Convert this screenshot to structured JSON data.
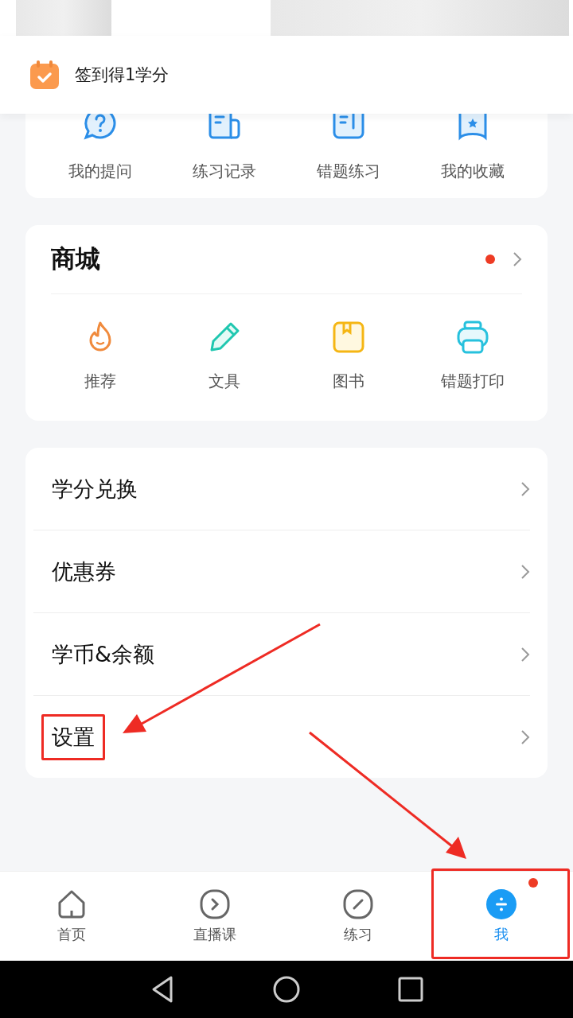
{
  "signin_banner": {
    "label": "签到得1学分"
  },
  "quick_links": [
    {
      "label": "我的提问",
      "kind": "question"
    },
    {
      "label": "练习记录",
      "kind": "record"
    },
    {
      "label": "错题练习",
      "kind": "notes"
    },
    {
      "label": "我的收藏",
      "kind": "bookmark"
    }
  ],
  "shop": {
    "title": "商城",
    "dot": true,
    "items": [
      {
        "label": "推荐",
        "kind": "flame"
      },
      {
        "label": "文具",
        "kind": "pencil"
      },
      {
        "label": "图书",
        "kind": "book"
      },
      {
        "label": "错题打印",
        "kind": "printer"
      }
    ]
  },
  "menu": [
    {
      "label": "学分兑换",
      "highlighted": false
    },
    {
      "label": "优惠券",
      "highlighted": false
    },
    {
      "label": "学币&余额",
      "highlighted": false
    },
    {
      "label": "设置",
      "highlighted": true
    }
  ],
  "tabs": [
    {
      "label": "首页",
      "kind": "home",
      "selected": false,
      "dot": false
    },
    {
      "label": "直播课",
      "kind": "live",
      "selected": false,
      "dot": false
    },
    {
      "label": "练习",
      "kind": "practice",
      "selected": false,
      "dot": false
    },
    {
      "label": "我",
      "kind": "me",
      "selected": true,
      "dot": true
    }
  ]
}
